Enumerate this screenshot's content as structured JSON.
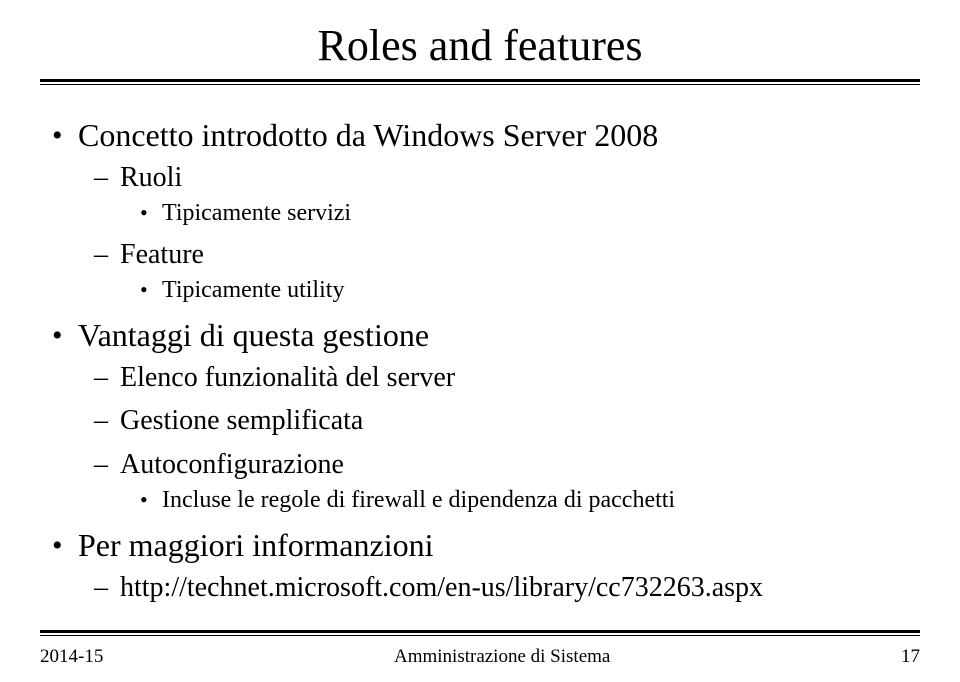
{
  "title": "Roles and features",
  "bullets": {
    "item1": "Concetto introdotto da Windows Server 2008",
    "item1_sub": {
      "s1": "Ruoli",
      "s1_sub": {
        "t1": "Tipicamente servizi"
      },
      "s2": "Feature",
      "s2_sub": {
        "t1": "Tipicamente utility"
      }
    },
    "item2": "Vantaggi di questa gestione",
    "item2_sub": {
      "s1": "Elenco funzionalità del server",
      "s2": "Gestione semplificata",
      "s3": "Autoconfigurazione",
      "s3_sub": {
        "t1": "Incluse le regole di firewall e dipendenza di pacchetti"
      }
    },
    "item3": "Per maggiori informanzioni",
    "item3_sub": {
      "s1": "http://technet.microsoft.com/en-us/library/cc732263.aspx"
    }
  },
  "footer": {
    "left": "2014-15",
    "center": "Amministrazione di Sistema",
    "right": "17"
  }
}
